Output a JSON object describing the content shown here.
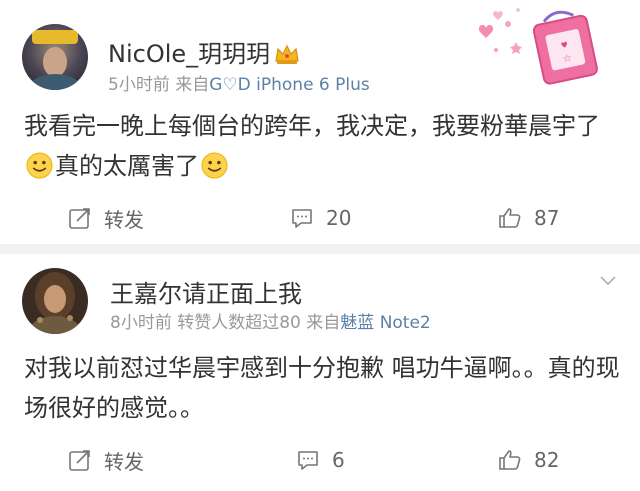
{
  "posts": [
    {
      "username": "NicOle_玥玥玥",
      "time": "5小时前",
      "source_prefix": "来自",
      "source": "G♡D iPhone 6 Plus",
      "content_part1": "我看完一晚上每個台的跨年，我决定，我要粉華晨宇了",
      "content_part2": "真的太厲害了",
      "actions": {
        "repost": "转发",
        "comments": "20",
        "likes": "87"
      },
      "icons": [
        "crown-icon",
        "smile-emoji-icon",
        "repost-icon",
        "comment-icon",
        "like-icon"
      ]
    },
    {
      "username": "王嘉尔请正面上我",
      "time": "8小时前",
      "extra": "转赞人数超过80",
      "source_prefix": "来自",
      "source": "魅蓝",
      "source_model": "Note2",
      "content": "对我以前怼过华晨宇感到十分抱歉 唱功牛逼啊。。真的现场很好的感觉。。",
      "actions": {
        "repost": "转发",
        "comments": "6",
        "likes": "82"
      }
    }
  ],
  "colors": {
    "source_link": "#5d7fa8",
    "meta_gray": "#999999",
    "separator": "#f2f2f2"
  }
}
